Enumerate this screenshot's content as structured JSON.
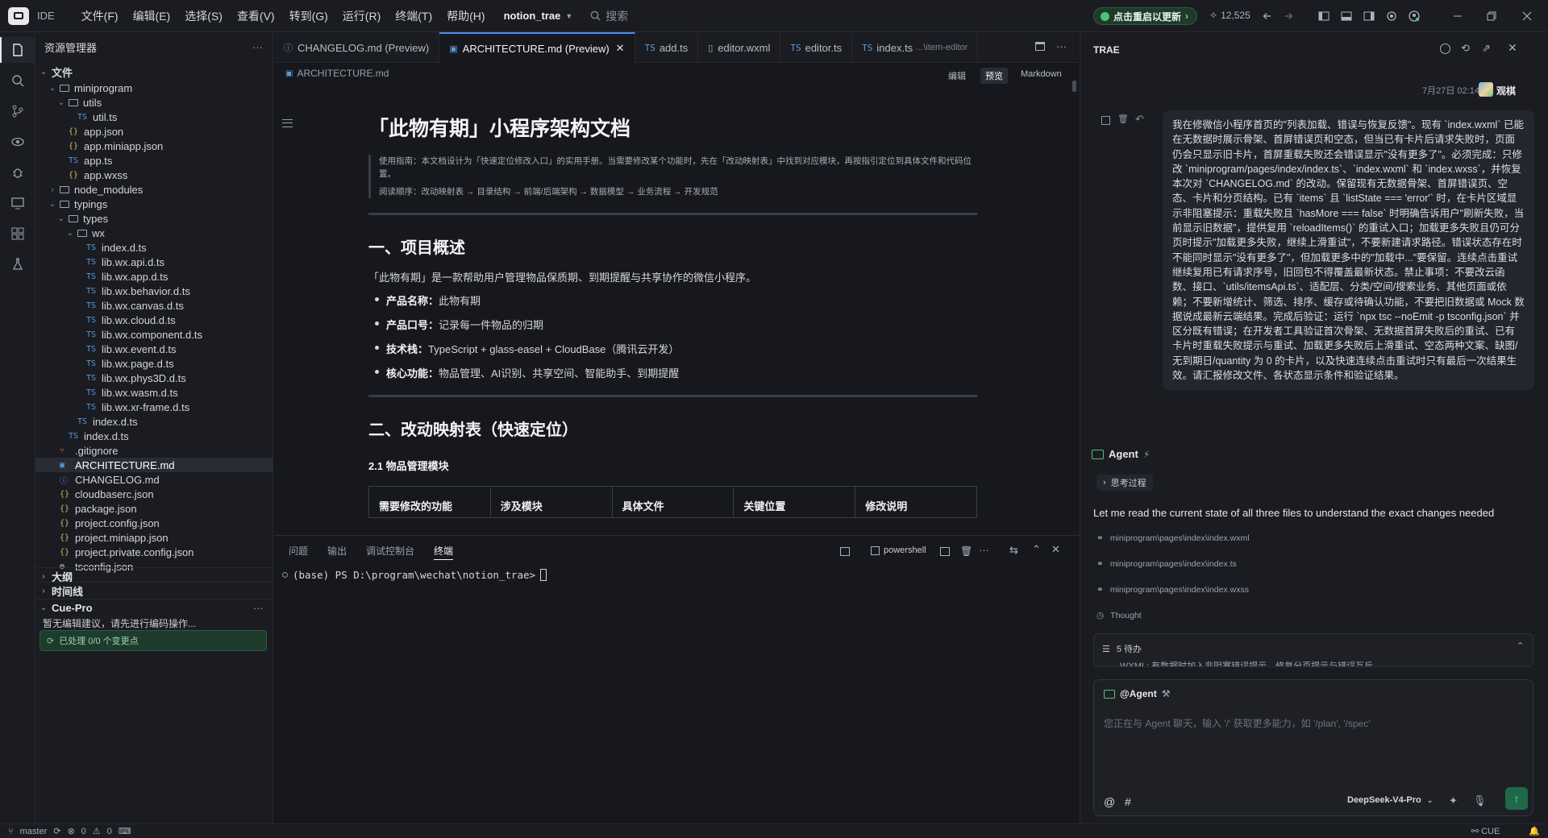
{
  "titlebar": {
    "ide": "IDE",
    "menu": [
      "文件(F)",
      "编辑(E)",
      "选择(S)",
      "查看(V)",
      "转到(G)",
      "运行(R)",
      "终端(T)",
      "帮助(H)"
    ],
    "project": "notion_trae",
    "search": "搜索",
    "update": "点击重启以更新",
    "stars": "12,525"
  },
  "explorer": {
    "title": "资源管理器",
    "root": "文件",
    "tree": [
      {
        "label": "miniprogram",
        "kind": "folder",
        "depth": 1,
        "open": true
      },
      {
        "label": "utils",
        "kind": "folder",
        "depth": 2,
        "open": true
      },
      {
        "label": "util.ts",
        "kind": "ts",
        "depth": 3
      },
      {
        "label": "app.json",
        "kind": "json",
        "depth": 2
      },
      {
        "label": "app.miniapp.json",
        "kind": "json",
        "depth": 2
      },
      {
        "label": "app.ts",
        "kind": "ts",
        "depth": 2
      },
      {
        "label": "app.wxss",
        "kind": "json",
        "depth": 2
      },
      {
        "label": "node_modules",
        "kind": "folder",
        "depth": 1,
        "open": false
      },
      {
        "label": "typings",
        "kind": "folder",
        "depth": 1,
        "open": true
      },
      {
        "label": "types",
        "kind": "folder",
        "depth": 2,
        "open": true
      },
      {
        "label": "wx",
        "kind": "folder",
        "depth": 3,
        "open": true
      },
      {
        "label": "index.d.ts",
        "kind": "ts",
        "depth": 4
      },
      {
        "label": "lib.wx.api.d.ts",
        "kind": "ts",
        "depth": 4
      },
      {
        "label": "lib.wx.app.d.ts",
        "kind": "ts",
        "depth": 4
      },
      {
        "label": "lib.wx.behavior.d.ts",
        "kind": "ts",
        "depth": 4
      },
      {
        "label": "lib.wx.canvas.d.ts",
        "kind": "ts",
        "depth": 4
      },
      {
        "label": "lib.wx.cloud.d.ts",
        "kind": "ts",
        "depth": 4
      },
      {
        "label": "lib.wx.component.d.ts",
        "kind": "ts",
        "depth": 4
      },
      {
        "label": "lib.wx.event.d.ts",
        "kind": "ts",
        "depth": 4
      },
      {
        "label": "lib.wx.page.d.ts",
        "kind": "ts",
        "depth": 4
      },
      {
        "label": "lib.wx.phys3D.d.ts",
        "kind": "ts",
        "depth": 4
      },
      {
        "label": "lib.wx.wasm.d.ts",
        "kind": "ts",
        "depth": 4
      },
      {
        "label": "lib.wx.xr-frame.d.ts",
        "kind": "ts",
        "depth": 4
      },
      {
        "label": "index.d.ts",
        "kind": "ts",
        "depth": 3
      },
      {
        "label": "index.d.ts",
        "kind": "ts",
        "depth": 2
      },
      {
        "label": ".gitignore",
        "kind": "git",
        "depth": 1
      },
      {
        "label": "ARCHITECTURE.md",
        "kind": "md",
        "depth": 1,
        "selected": true
      },
      {
        "label": "CHANGELOG.md",
        "kind": "info",
        "depth": 1
      },
      {
        "label": "cloudbaserc.json",
        "kind": "json",
        "depth": 1
      },
      {
        "label": "package.json",
        "kind": "json",
        "depth": 1
      },
      {
        "label": "project.config.json",
        "kind": "json",
        "depth": 1
      },
      {
        "label": "project.miniapp.json",
        "kind": "json",
        "depth": 1
      },
      {
        "label": "project.private.config.json",
        "kind": "json",
        "depth": 1
      },
      {
        "label": "tsconfig.json",
        "kind": "gear",
        "depth": 1
      }
    ],
    "outline": "大纲",
    "timeline": "时间线",
    "cue_title": "Cue-Pro",
    "cue_msg": "暂无编辑建议，请先进行编码操作...",
    "cue_btn": "已处理 0/0 个变更点"
  },
  "editor": {
    "tabs": [
      {
        "label": "CHANGELOG.md (Preview)",
        "icon": "info"
      },
      {
        "label": "ARCHITECTURE.md (Preview)",
        "icon": "md",
        "active": true
      },
      {
        "label": "add.ts",
        "icon": "TS"
      },
      {
        "label": "editor.wxml",
        "icon": "file"
      },
      {
        "label": "editor.ts",
        "icon": "TS"
      },
      {
        "label": "index.ts",
        "icon": "TS",
        "suffix": "...\\item-editor"
      }
    ],
    "breadcrumb": "ARCHITECTURE.md",
    "modes": [
      "编辑",
      "预览",
      "Markdown"
    ],
    "doc": {
      "title": "「此物有期」小程序架构文档",
      "guide": "使用指南：本文档设计为「快速定位修改入口」的实用手册。当需要修改某个功能时，先在「改动映射表」中找到对应模块，再按指引定位到具体文件和代码位置。",
      "order": "阅读顺序：改动映射表 → 目录结构 → 前端/后端架构 → 数据模型 → 业务流程 → 开发规范",
      "h2_1": "一、项目概述",
      "intro": "「此物有期」是一款帮助用户管理物品保质期、到期提醒与共享协作的微信小程序。",
      "bullets": [
        {
          "k": "产品名称：",
          "v": "此物有期"
        },
        {
          "k": "产品口号：",
          "v": "记录每一件物品的归期"
        },
        {
          "k": "技术栈：",
          "v": "TypeScript + glass-easel + CloudBase（腾讯云开发）"
        },
        {
          "k": "核心功能：",
          "v": "物品管理、AI识别、共享空间、智能助手、到期提醒"
        }
      ],
      "h2_2": "二、改动映射表（快速定位）",
      "h3": "2.1 物品管理模块",
      "table_head": [
        "需要修改的功能",
        "涉及模块",
        "具体文件",
        "关键位置",
        "修改说明"
      ]
    }
  },
  "terminal": {
    "tabs": [
      "问题",
      "输出",
      "调试控制台",
      "终端"
    ],
    "shell": "powershell",
    "prompt": "(base) PS D:\\program\\wechat\\notion_trae>"
  },
  "chat": {
    "title": "TRAE",
    "time": "7月27日 02:14",
    "user": "观棋",
    "message": "我在修微信小程序首页的\"列表加载、错误与恢复反馈\"。现有 `index.wxml` 已能在无数据时展示骨架、首屏错误页和空态，但当已有卡片后请求失败时，页面仍会只显示旧卡片，首屏重载失败还会错误显示\"没有更多了\"。必须完成：只修改 `miniprogram/pages/index/index.ts`、`index.wxml` 和 `index.wxss`，并恢复本次对 `CHANGELOG.md` 的改动。保留现有无数据骨架、首屏错误页、空态、卡片和分页结构。已有 `items` 且 `listState === 'error'` 时，在卡片区域显示非阻塞提示：重载失败且 `hasMore === false` 时明确告诉用户\"刷新失败，当前显示旧数据\"，提供复用 `reloadItems()` 的重试入口；加载更多失败且仍可分页时提示\"加载更多失败，继续上滑重试\"，不要新建请求路径。错误状态存在时不能同时显示\"没有更多了\"，但加载更多中的\"加载中...\"要保留。连续点击重试继续复用已有请求序号，旧回包不得覆盖最新状态。禁止事项：不要改云函数、接口、`utils/itemsApi.ts`、适配层、分类/空间/搜索业务、其他页面或依赖；不要新增统计、筛选、排序、缓存或待确认功能，不要把旧数据或 Mock 数据说成最新云端结果。完成后验证：运行 `npx tsc --noEmit -p tsconfig.json` 并区分既有错误；在开发者工具验证首次骨架、无数据首屏失败后的重试、已有卡片时重载失败提示与重试、加载更多失败后上滑重试、空态两种文案、缺图/无到期日/quantity 为 0 的卡片，以及快速连续点击重试时只有最后一次结果生效。请汇报修改文件、各状态显示条件和验证结果。",
    "agent": "Agent",
    "think": "思考过程",
    "response": "Let me read the current state of all three files to understand the exact changes needed",
    "files": [
      "miniprogram\\pages\\index\\index.wxml",
      "miniprogram\\pages\\index\\index.ts",
      "miniprogram\\pages\\index\\index.wxss"
    ],
    "thought": "Thought",
    "todo": "5 待办",
    "todo_item": "WXML: 有数据时加入非阻塞错误提示，修复分页提示与错误互斥",
    "input_agent": "@Agent",
    "placeholder": "您正在与 Agent 聊天，输入 '/' 获取更多能力，如 '/plan', '/spec'",
    "model": "DeepSeek-V4-Pro"
  },
  "status": {
    "branch": "master",
    "errors": "0",
    "warnings": "0",
    "cue": "CUE"
  },
  "colors": {
    "accent": "#4a8cf0",
    "green": "#1e6a48",
    "bg": "#17181d"
  }
}
